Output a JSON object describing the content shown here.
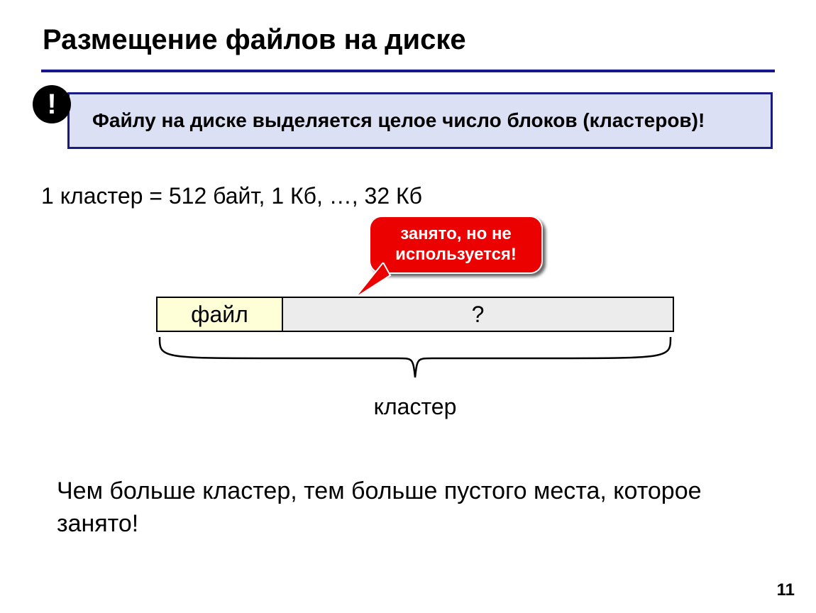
{
  "title": "Размещение файлов на диске",
  "badge": "!",
  "callout": "Файлу на диске выделяется целое число блоков (кластеров)!",
  "cluster_sizes_line": "1 кластер = 512 байт, 1 Кб, …, 32 Кб",
  "bubble_line1": "занято, но не",
  "bubble_line2": "используется!",
  "cell_file_label": "файл",
  "cell_empty_label": "?",
  "brace_label": "кластер",
  "conclusion": "Чем больше кластер, тем больше пустого места, которое занято!",
  "page_number": "11"
}
